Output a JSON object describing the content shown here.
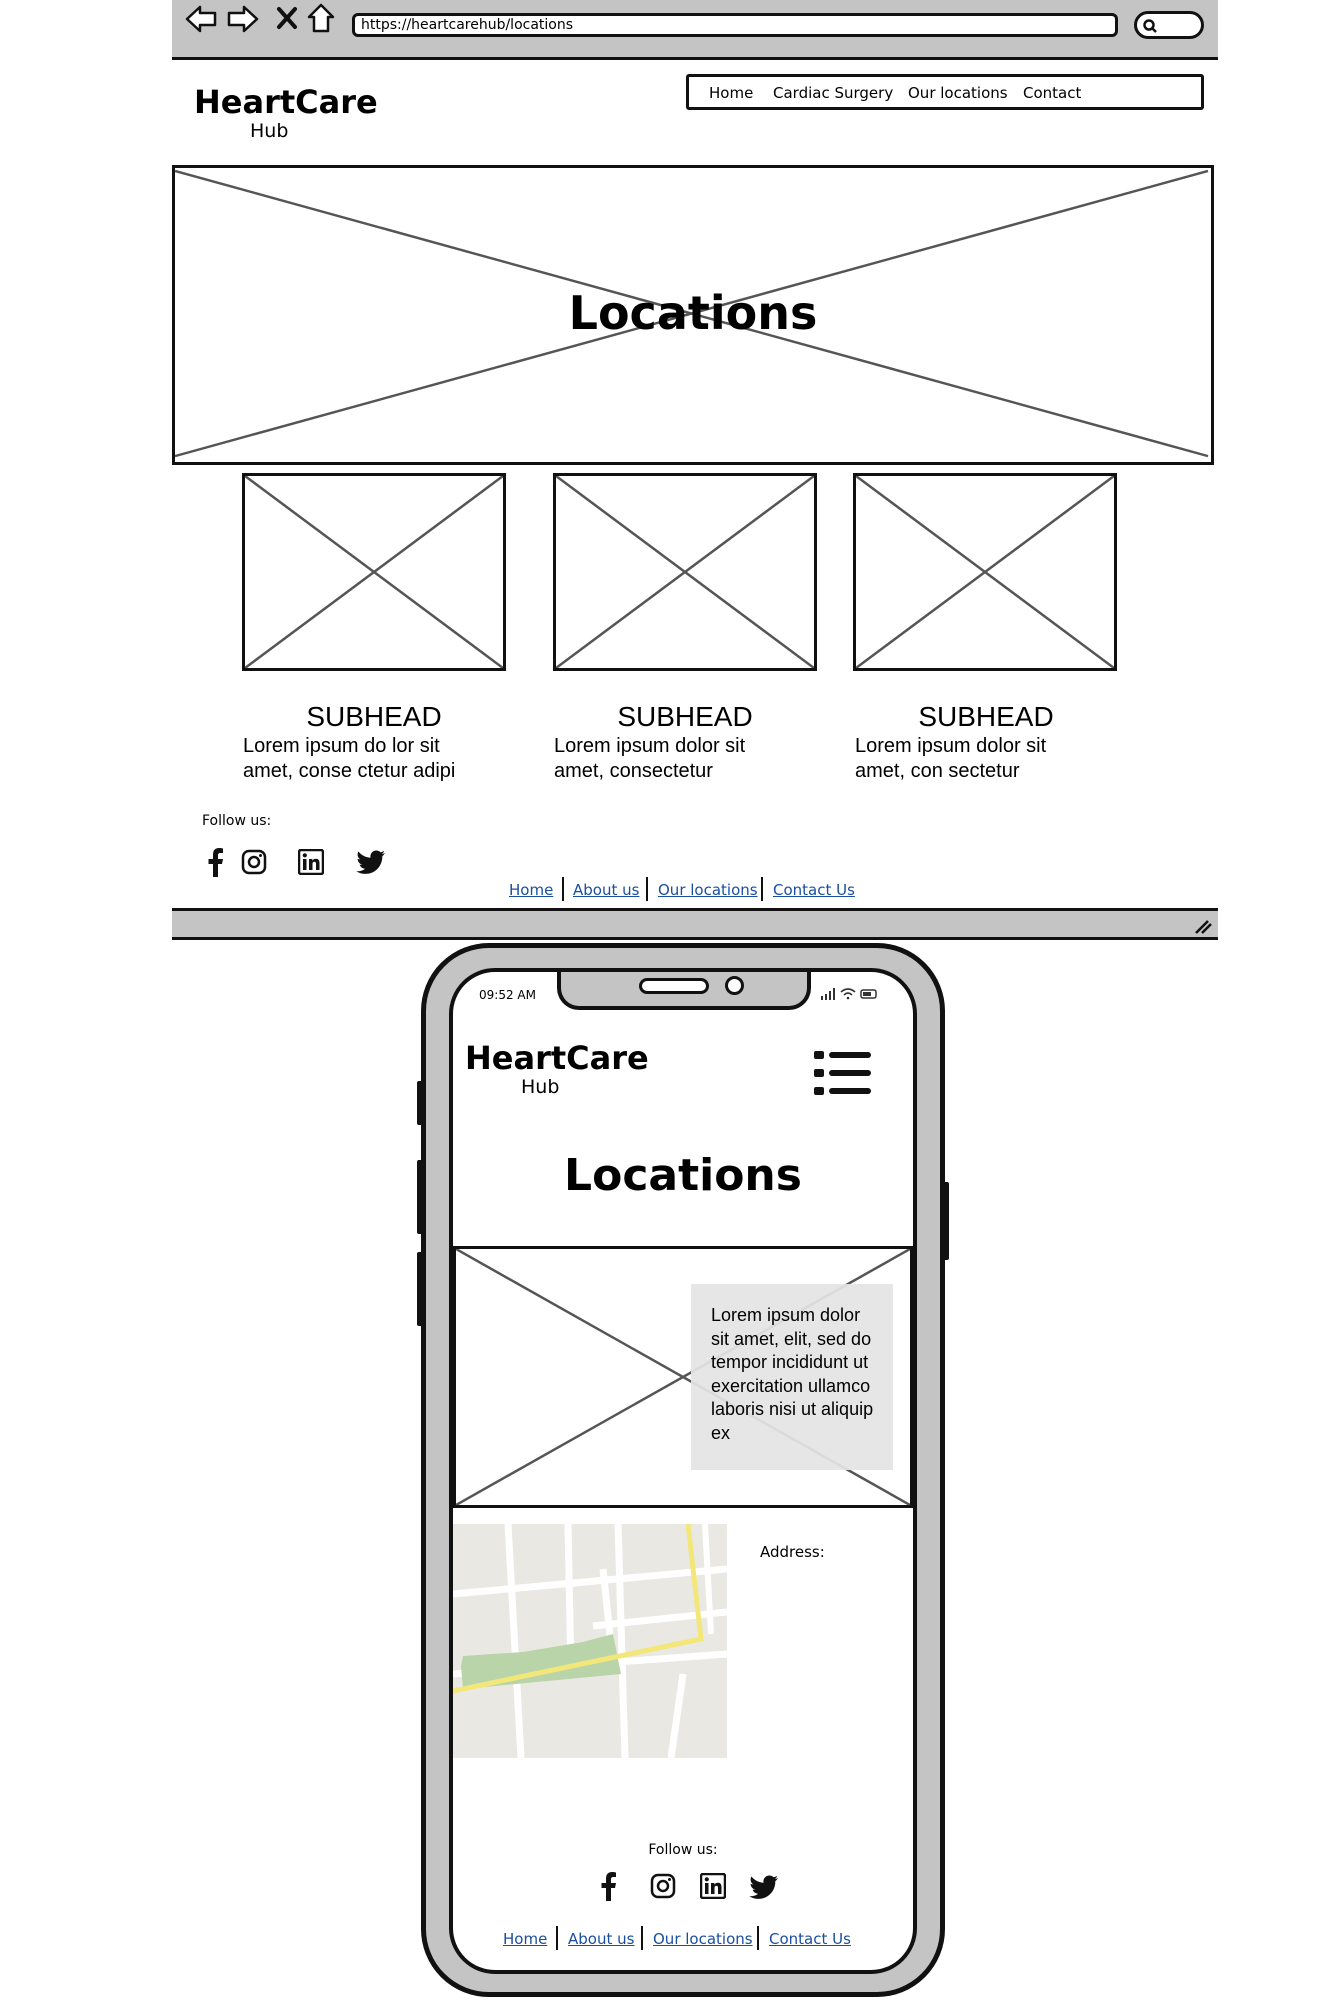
{
  "browser": {
    "url": "https://heartcarehub/locations",
    "icons": [
      "back-arrow-icon",
      "forward-arrow-icon",
      "close-icon",
      "home-icon",
      "search-icon"
    ]
  },
  "desktop": {
    "logo": {
      "line1": "HeartCare",
      "line2": "Hub"
    },
    "nav": [
      "Home",
      "Cardiac Surgery",
      "Our locations",
      "Contact"
    ],
    "hero_title": "Locations",
    "cards": [
      {
        "subhead": "SUBHEAD",
        "line1": "Lorem ipsum do lor sit",
        "line2": "amet, conse ctetur adipi"
      },
      {
        "subhead": "SUBHEAD",
        "line1": "Lorem ipsum dolor sit",
        "line2": "amet, consectetur"
      },
      {
        "subhead": "SUBHEAD",
        "line1": "Lorem ipsum dolor sit",
        "line2": "amet, con sectetur"
      }
    ],
    "follow_label": "Follow us:",
    "social_icons": [
      "facebook-icon",
      "instagram-icon",
      "linkedin-icon",
      "twitter-icon"
    ],
    "footer_links": [
      "Home",
      "About us",
      "Our locations",
      "Contact Us"
    ]
  },
  "phone": {
    "time": "09:52 AM",
    "logo": {
      "line1": "HeartCare",
      "line2": "Hub"
    },
    "menu_icon": "hamburger-list-icon",
    "title": "Locations",
    "overlay_text": "Lorem ipsum dolor sit amet, elit, sed do tempor incididunt ut exercitation ullamco laboris nisi ut aliquip ex",
    "address_label": "Address:",
    "follow_label": "Follow us:",
    "footer_links": [
      "Home",
      "About us",
      "Our locations",
      "Contact Us"
    ]
  },
  "colors": {
    "chrome_gray": "#c4c4c4",
    "link_blue": "#1a4fa0",
    "map_park": "#b9d4a9",
    "map_road_yellow": "#f3e77a",
    "map_block": "#e8e6e1"
  }
}
